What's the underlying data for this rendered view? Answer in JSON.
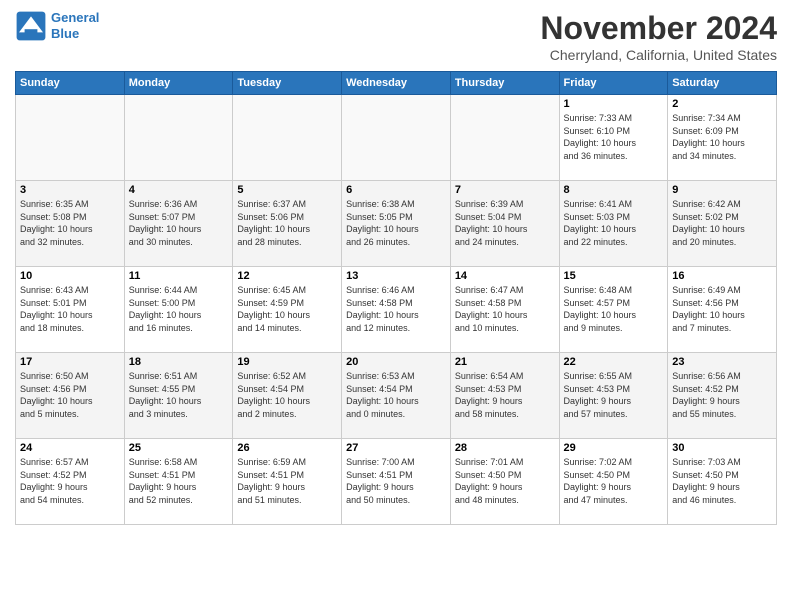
{
  "logo": {
    "line1": "General",
    "line2": "Blue"
  },
  "title": "November 2024",
  "subtitle": "Cherryland, California, United States",
  "weekdays": [
    "Sunday",
    "Monday",
    "Tuesday",
    "Wednesday",
    "Thursday",
    "Friday",
    "Saturday"
  ],
  "weeks": [
    [
      {
        "day": "",
        "content": ""
      },
      {
        "day": "",
        "content": ""
      },
      {
        "day": "",
        "content": ""
      },
      {
        "day": "",
        "content": ""
      },
      {
        "day": "",
        "content": ""
      },
      {
        "day": "1",
        "content": "Sunrise: 7:33 AM\nSunset: 6:10 PM\nDaylight: 10 hours\nand 36 minutes."
      },
      {
        "day": "2",
        "content": "Sunrise: 7:34 AM\nSunset: 6:09 PM\nDaylight: 10 hours\nand 34 minutes."
      }
    ],
    [
      {
        "day": "3",
        "content": "Sunrise: 6:35 AM\nSunset: 5:08 PM\nDaylight: 10 hours\nand 32 minutes."
      },
      {
        "day": "4",
        "content": "Sunrise: 6:36 AM\nSunset: 5:07 PM\nDaylight: 10 hours\nand 30 minutes."
      },
      {
        "day": "5",
        "content": "Sunrise: 6:37 AM\nSunset: 5:06 PM\nDaylight: 10 hours\nand 28 minutes."
      },
      {
        "day": "6",
        "content": "Sunrise: 6:38 AM\nSunset: 5:05 PM\nDaylight: 10 hours\nand 26 minutes."
      },
      {
        "day": "7",
        "content": "Sunrise: 6:39 AM\nSunset: 5:04 PM\nDaylight: 10 hours\nand 24 minutes."
      },
      {
        "day": "8",
        "content": "Sunrise: 6:41 AM\nSunset: 5:03 PM\nDaylight: 10 hours\nand 22 minutes."
      },
      {
        "day": "9",
        "content": "Sunrise: 6:42 AM\nSunset: 5:02 PM\nDaylight: 10 hours\nand 20 minutes."
      }
    ],
    [
      {
        "day": "10",
        "content": "Sunrise: 6:43 AM\nSunset: 5:01 PM\nDaylight: 10 hours\nand 18 minutes."
      },
      {
        "day": "11",
        "content": "Sunrise: 6:44 AM\nSunset: 5:00 PM\nDaylight: 10 hours\nand 16 minutes."
      },
      {
        "day": "12",
        "content": "Sunrise: 6:45 AM\nSunset: 4:59 PM\nDaylight: 10 hours\nand 14 minutes."
      },
      {
        "day": "13",
        "content": "Sunrise: 6:46 AM\nSunset: 4:58 PM\nDaylight: 10 hours\nand 12 minutes."
      },
      {
        "day": "14",
        "content": "Sunrise: 6:47 AM\nSunset: 4:58 PM\nDaylight: 10 hours\nand 10 minutes."
      },
      {
        "day": "15",
        "content": "Sunrise: 6:48 AM\nSunset: 4:57 PM\nDaylight: 10 hours\nand 9 minutes."
      },
      {
        "day": "16",
        "content": "Sunrise: 6:49 AM\nSunset: 4:56 PM\nDaylight: 10 hours\nand 7 minutes."
      }
    ],
    [
      {
        "day": "17",
        "content": "Sunrise: 6:50 AM\nSunset: 4:56 PM\nDaylight: 10 hours\nand 5 minutes."
      },
      {
        "day": "18",
        "content": "Sunrise: 6:51 AM\nSunset: 4:55 PM\nDaylight: 10 hours\nand 3 minutes."
      },
      {
        "day": "19",
        "content": "Sunrise: 6:52 AM\nSunset: 4:54 PM\nDaylight: 10 hours\nand 2 minutes."
      },
      {
        "day": "20",
        "content": "Sunrise: 6:53 AM\nSunset: 4:54 PM\nDaylight: 10 hours\nand 0 minutes."
      },
      {
        "day": "21",
        "content": "Sunrise: 6:54 AM\nSunset: 4:53 PM\nDaylight: 9 hours\nand 58 minutes."
      },
      {
        "day": "22",
        "content": "Sunrise: 6:55 AM\nSunset: 4:53 PM\nDaylight: 9 hours\nand 57 minutes."
      },
      {
        "day": "23",
        "content": "Sunrise: 6:56 AM\nSunset: 4:52 PM\nDaylight: 9 hours\nand 55 minutes."
      }
    ],
    [
      {
        "day": "24",
        "content": "Sunrise: 6:57 AM\nSunset: 4:52 PM\nDaylight: 9 hours\nand 54 minutes."
      },
      {
        "day": "25",
        "content": "Sunrise: 6:58 AM\nSunset: 4:51 PM\nDaylight: 9 hours\nand 52 minutes."
      },
      {
        "day": "26",
        "content": "Sunrise: 6:59 AM\nSunset: 4:51 PM\nDaylight: 9 hours\nand 51 minutes."
      },
      {
        "day": "27",
        "content": "Sunrise: 7:00 AM\nSunset: 4:51 PM\nDaylight: 9 hours\nand 50 minutes."
      },
      {
        "day": "28",
        "content": "Sunrise: 7:01 AM\nSunset: 4:50 PM\nDaylight: 9 hours\nand 48 minutes."
      },
      {
        "day": "29",
        "content": "Sunrise: 7:02 AM\nSunset: 4:50 PM\nDaylight: 9 hours\nand 47 minutes."
      },
      {
        "day": "30",
        "content": "Sunrise: 7:03 AM\nSunset: 4:50 PM\nDaylight: 9 hours\nand 46 minutes."
      }
    ]
  ]
}
